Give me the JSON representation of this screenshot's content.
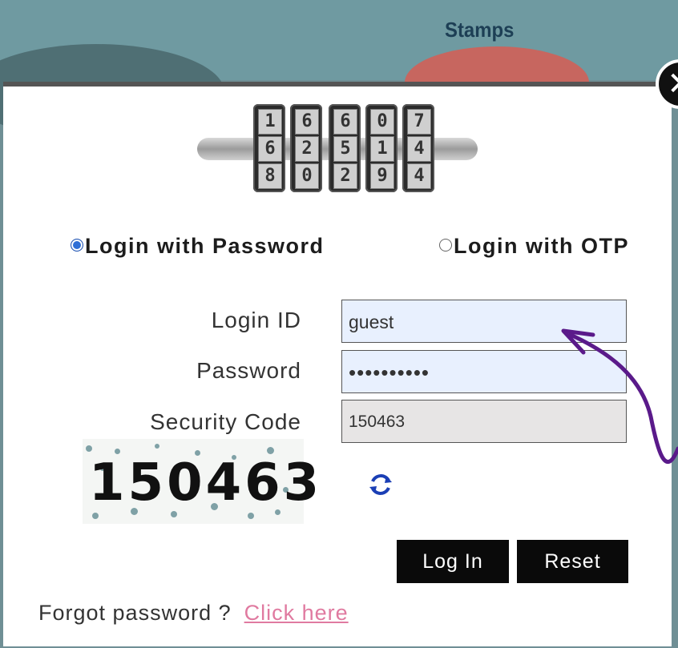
{
  "background": {
    "title": "Stamps"
  },
  "modal": {
    "close_icon": "close-icon",
    "lock_icon": "combination-lock-icon",
    "lock_digits": [
      [
        "1",
        "6",
        "8"
      ],
      [
        "6",
        "2",
        "0"
      ],
      [
        "6",
        "5",
        "2"
      ],
      [
        "0",
        "1",
        "9"
      ],
      [
        "7",
        "4",
        "4"
      ]
    ],
    "login_options": {
      "password_label": "Login with Password",
      "otp_label": "Login with OTP",
      "selected": "password"
    },
    "fields": {
      "login_id_label": "Login ID",
      "login_id_value": "guest",
      "password_label": "Password",
      "password_value": "••••••••••",
      "security_code_label": "Security Code",
      "security_code_value": "150463"
    },
    "captcha": {
      "code": "150463"
    },
    "refresh_icon": "refresh-icon",
    "buttons": {
      "login": "Log In",
      "reset": "Reset"
    },
    "forgot": {
      "text": "Forgot password ?",
      "link": "Click here"
    }
  },
  "colors": {
    "selected_radio": "#2f6fd6",
    "button_bg": "#0a0a0a",
    "link": "#e07aa0",
    "annotation": "#5a1a8a"
  }
}
